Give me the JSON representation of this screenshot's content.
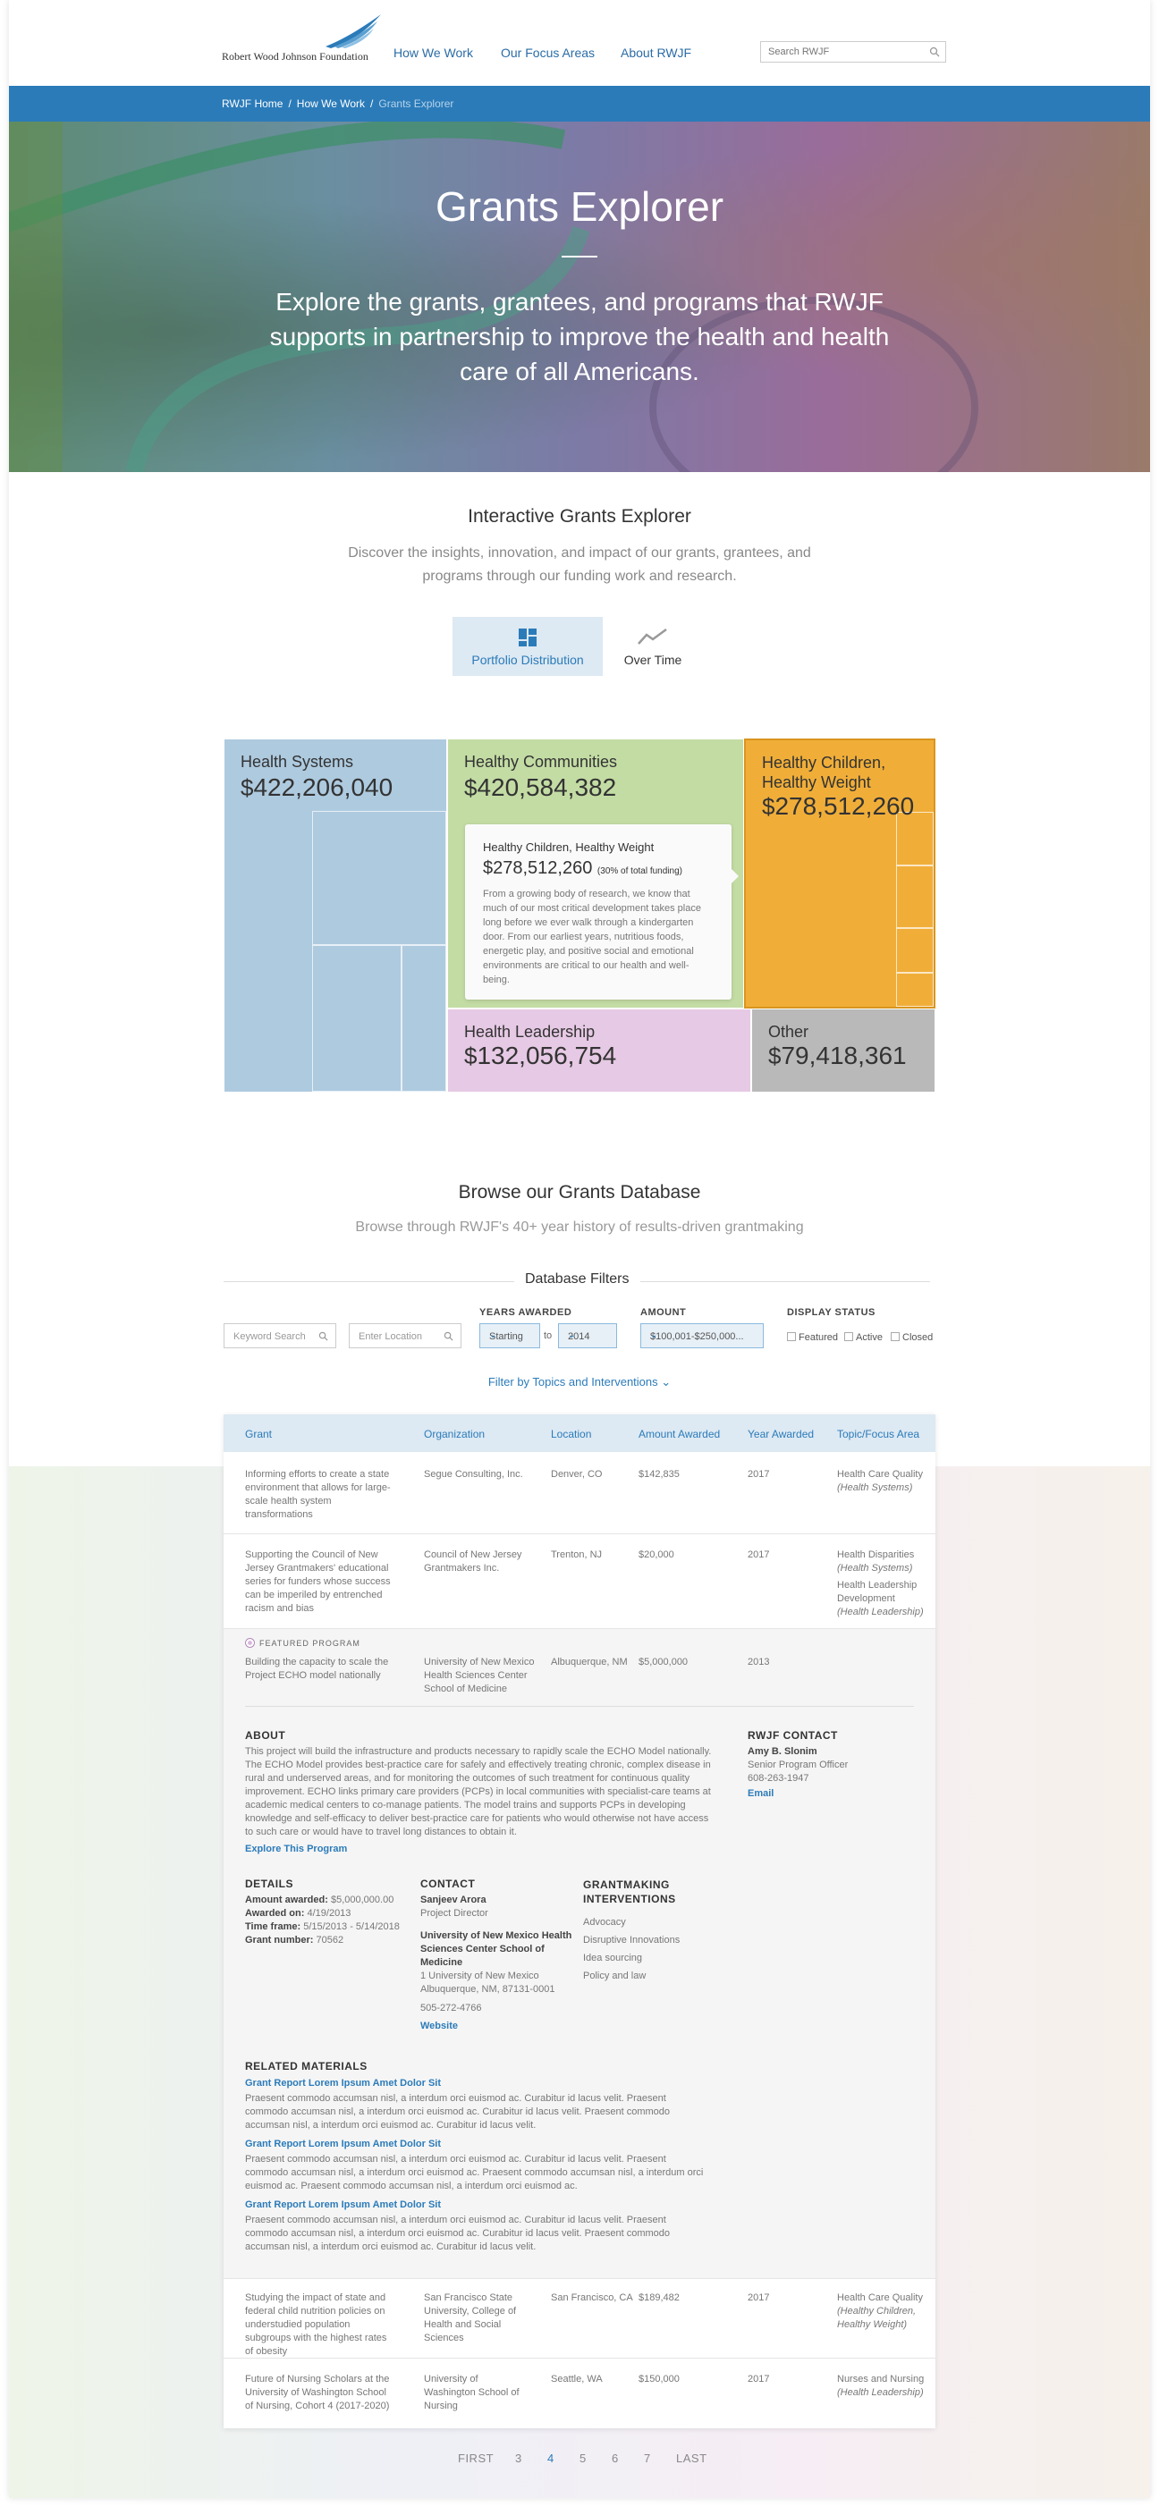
{
  "header": {
    "logo_text": "Robert Wood Johnson Foundation",
    "nav": [
      "How We Work",
      "Our Focus Areas",
      "About RWJF"
    ],
    "search_placeholder": "Search RWJF"
  },
  "breadcrumb": [
    "RWJF Home",
    "How We Work",
    "Grants Explorer"
  ],
  "hero": {
    "title": "Grants Explorer",
    "subtitle": "Explore the grants, grantees, and programs that RWJF supports in partnership to improve the health and health care of all Americans."
  },
  "intro": {
    "title": "Interactive Grants Explorer",
    "subtitle": "Discover the insights, innovation, and impact of our grants, grantees, and programs through our funding work and research.",
    "tabs": [
      "Portfolio Distribution",
      "Over Time"
    ]
  },
  "treemap": {
    "tiles": [
      {
        "name": "Health Systems",
        "amount": "422,206,040",
        "color": "#aecadf"
      },
      {
        "name": "Healthy Communities",
        "amount": "420,584,382",
        "color": "#c3dca4"
      },
      {
        "name": "Healthy Children, Healthy Weight",
        "amount": "278,512,260",
        "color": "#f0ae39"
      },
      {
        "name": "Health Leadership",
        "amount": "132,056,754",
        "color": "#e6c9e4"
      },
      {
        "name": "Other",
        "amount": "79,418,361",
        "color": "#b9b9b9"
      }
    ],
    "currency": "$",
    "tooltip": {
      "title": "Healthy Children, Healthy Weight",
      "amount": "278,512,260",
      "share": "(30% of total funding)",
      "description": "From a growing body of research, we know that much of our most critical development takes place long before we ever walk through a kindergarten door. From our earliest years, nutritious foods, energetic play, and positive social and emotional environments are critical to our health and well-being."
    }
  },
  "browse": {
    "title": "Browse our Grants Database",
    "subtitle": "Browse through RWJF's 40+ year history of results-driven grantmaking"
  },
  "filters": {
    "title": "Database Filters",
    "keyword_placeholder": "Keyword Search",
    "location_placeholder": "Enter Location",
    "years_label": "YEARS AWARDED",
    "year_start": "Starting",
    "to": "to",
    "year_end": "2014",
    "amount_label": "AMOUNT",
    "amount_value": "$100,001-$250,000...",
    "status_label": "DISPLAY STATUS",
    "status_options": [
      "Featured",
      "Active",
      "Closed"
    ],
    "topic_filter": "Filter by Topics and Interventions"
  },
  "table": {
    "headers": [
      "Grant",
      "Organization",
      "Location",
      "Amount Awarded",
      "Year Awarded",
      "Topic/Focus Area"
    ],
    "rows": [
      {
        "grant": "Informing efforts to create a state environment that allows for large-scale health system transformations",
        "org": "Segue Consulting, Inc.",
        "location": "Denver, CO",
        "amount": "$142,835",
        "year": "2017",
        "topic": "Health Care Quality",
        "topic_sub": "(Health Systems)"
      },
      {
        "grant": "Supporting the Council of New Jersey Grantmakers' educational series for funders whose success can be imperiled by entrenched racism and bias",
        "org": "Council of New Jersey Grantmakers Inc.",
        "location": "Trenton, NJ",
        "amount": "$20,000",
        "year": "2017",
        "topic": "Health Disparities",
        "topic_sub": "(Health Systems)",
        "topic2": "Health Leadership Development",
        "topic2_sub": "(Health Leadership)"
      },
      {
        "grant": "Studying the impact of state and federal child nutrition policies on understudied population subgroups with the highest rates of obesity",
        "org": "San Francisco State University, College of Health and Social Sciences",
        "location": "San Francisco, CA",
        "amount": "$189,482",
        "year": "2017",
        "topic": "Health Care Quality",
        "topic_sub": "(Healthy Children, Healthy Weight)"
      },
      {
        "grant": "Future of Nursing Scholars at the University of Washington School of Nursing, Cohort 4 (2017-2020)",
        "org": "University of Washington School of Nursing",
        "location": "Seattle, WA",
        "amount": "$150,000",
        "year": "2017",
        "topic": "Nurses and Nursing",
        "topic_sub": "(Health Leadership)"
      }
    ],
    "featured": {
      "badge": "FEATURED PROGRAM",
      "grant": "Building the capacity to scale the Project ECHO model nationally",
      "org": "University of New Mexico Health Sciences Center School of Medicine",
      "location": "Albuquerque, NM",
      "amount": "$5,000,000",
      "year": "2013",
      "about_title": "ABOUT",
      "about": "This project will build the infrastructure and products necessary to rapidly scale the ECHO Model nationally. The ECHO Model provides best-practice care for safely and effectively treating chronic, complex disease in rural and underserved areas, and for monitoring the outcomes of such treatment for continuous quality improvement. ECHO links primary care providers (PCPs) in local communities with specialist-care teams at academic medical centers to co-manage patients. The model trains and supports PCPs in developing knowledge and self-efficacy to deliver best-practice care for patients who would otherwise not have access to such care or would have to travel long distances to obtain it.",
      "explore_link": "Explore This Program",
      "rwjf_contact_title": "RWJF CONTACT",
      "rwjf_contact_name": "Amy B. Slonim",
      "rwjf_contact_role": "Senior Program Officer",
      "rwjf_contact_phone": "608-263-1947",
      "rwjf_contact_email": "Email",
      "details_title": "DETAILS",
      "details": [
        {
          "label": "Amount awarded:",
          "value": "$5,000,000.00"
        },
        {
          "label": "Awarded on:",
          "value": "4/19/2013"
        },
        {
          "label": "Time frame:",
          "value": "5/15/2013 - 5/14/2018"
        },
        {
          "label": "Grant number:",
          "value": "70562"
        }
      ],
      "contact_title": "CONTACT",
      "contact_name": "Sanjeev Arora",
      "contact_role": "Project Director",
      "contact_org": "University of New Mexico Health Sciences Center School of Medicine",
      "contact_addr1": "1 University of New Mexico",
      "contact_addr2": "Albuquerque, NM, 87131-0001",
      "contact_phone": "505-272-4766",
      "contact_web": "Website",
      "interventions_title": "GRANTMAKING INTERVENTIONS",
      "interventions": [
        "Advocacy",
        "Disruptive Innovations",
        "Idea sourcing",
        "Policy and law"
      ],
      "related_title": "RELATED MATERIALS",
      "related": [
        {
          "title": "Grant Report Lorem Ipsum Amet Dolor Sit",
          "body": "Praesent commodo accumsan nisl, a interdum orci euismod ac. Curabitur id lacus velit. Praesent commodo accumsan nisl, a interdum orci euismod ac. Curabitur id lacus velit. Praesent commodo accumsan nisl, a interdum orci euismod ac. Curabitur id lacus velit."
        },
        {
          "title": "Grant Report Lorem Ipsum Amet Dolor Sit",
          "body": "Praesent commodo accumsan nisl, a interdum orci euismod ac. Curabitur id lacus velit. Praesent commodo accumsan nisl, a interdum orci euismod ac. Praesent commodo accumsan nisl, a interdum orci euismod ac. Praesent commodo accumsan nisl, a interdum orci euismod ac."
        },
        {
          "title": "Grant Report Lorem Ipsum Amet Dolor Sit",
          "body": "Praesent commodo accumsan nisl, a interdum orci euismod ac. Curabitur id lacus velit. Praesent commodo accumsan nisl, a interdum orci euismod ac. Curabitur id lacus velit. Praesent commodo accumsan nisl, a interdum orci euismod ac. Curabitur id lacus velit."
        }
      ]
    }
  },
  "pagination": [
    "FIRST",
    "3",
    "4",
    "5",
    "6",
    "7",
    "LAST"
  ],
  "pagination_active": "4"
}
